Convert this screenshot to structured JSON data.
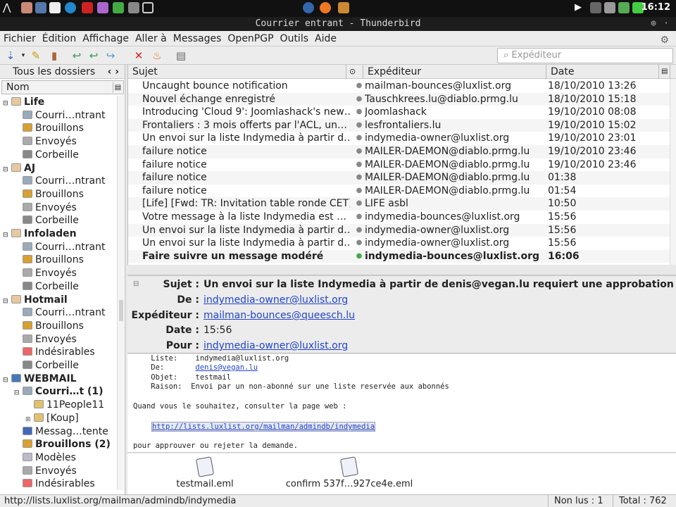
{
  "system_bar": {
    "clock": "16:12"
  },
  "window": {
    "title": "Courrier entrant - Thunderbird"
  },
  "menu": [
    "Fichier",
    "Édition",
    "Affichage",
    "Aller à",
    "Messages",
    "OpenPGP",
    "Outils",
    "Aide"
  ],
  "toolbar": {
    "search_placeholder": "Expéditeur"
  },
  "folder_pane": {
    "header": "Tous les dossiers",
    "header_toggle": "‹ ›",
    "column": "Nom",
    "folders": [
      {
        "label": "Life",
        "bold": true,
        "level": 0,
        "icon": "account-icon",
        "twisty": "⊟"
      },
      {
        "label": "Courri…ntrant",
        "level": 1,
        "icon": "inbox-icon"
      },
      {
        "label": "Brouillons",
        "level": 1,
        "icon": "drafts-icon"
      },
      {
        "label": "Envoyés",
        "level": 1,
        "icon": "sent-icon"
      },
      {
        "label": "Corbeille",
        "level": 1,
        "icon": "trash-icon"
      },
      {
        "label": "AJ",
        "bold": true,
        "level": 0,
        "icon": "account-icon",
        "twisty": "⊟"
      },
      {
        "label": "Courri…ntrant",
        "level": 1,
        "icon": "inbox-icon"
      },
      {
        "label": "Brouillons",
        "level": 1,
        "icon": "drafts-icon"
      },
      {
        "label": "Envoyés",
        "level": 1,
        "icon": "sent-icon"
      },
      {
        "label": "Corbeille",
        "level": 1,
        "icon": "trash-icon"
      },
      {
        "label": "Infoladen",
        "bold": true,
        "level": 0,
        "icon": "account-icon",
        "twisty": "⊟"
      },
      {
        "label": "Courri…ntrant",
        "level": 1,
        "icon": "inbox-icon"
      },
      {
        "label": "Brouillons",
        "level": 1,
        "icon": "drafts-icon"
      },
      {
        "label": "Envoyés",
        "level": 1,
        "icon": "sent-icon"
      },
      {
        "label": "Corbeille",
        "level": 1,
        "icon": "trash-icon"
      },
      {
        "label": "Hotmail",
        "bold": true,
        "level": 0,
        "icon": "account-icon",
        "twisty": "⊟"
      },
      {
        "label": "Courri…ntrant",
        "level": 1,
        "icon": "inbox-icon"
      },
      {
        "label": "Brouillons",
        "level": 1,
        "icon": "drafts-icon"
      },
      {
        "label": "Envoyés",
        "level": 1,
        "icon": "sent-icon"
      },
      {
        "label": "Indésirables",
        "level": 1,
        "icon": "junk-icon"
      },
      {
        "label": "Corbeille",
        "level": 1,
        "icon": "trash-icon"
      },
      {
        "label": "WEBMAIL",
        "bold": true,
        "level": 0,
        "icon": "imap-account-icon",
        "twisty": "⊟"
      },
      {
        "label": "Courri…t (1)",
        "bold": true,
        "level": 1,
        "icon": "inbox-icon",
        "twisty": "⊟"
      },
      {
        "label": "11People11",
        "level": 2,
        "icon": "folder-icon"
      },
      {
        "label": "[Koup]",
        "level": 2,
        "icon": "folder-icon",
        "twisty": "⊞"
      },
      {
        "label": "Messag…tente",
        "level": 1,
        "icon": "outbox-icon"
      },
      {
        "label": "Brouillons (2)",
        "bold": true,
        "level": 1,
        "icon": "drafts-icon"
      },
      {
        "label": "Modèles",
        "level": 1,
        "icon": "templates-icon"
      },
      {
        "label": "Envoyés",
        "level": 1,
        "icon": "sent-icon"
      },
      {
        "label": "Indésirables",
        "level": 1,
        "icon": "junk-icon"
      }
    ]
  },
  "thread_pane": {
    "columns": {
      "subject": "Sujet",
      "from": "Expéditeur",
      "date": "Date"
    },
    "rows": [
      {
        "subject": "Uncaught bounce notification",
        "from": "mailman-bounces@luxlist.org",
        "date": "18/10/2010 13:26"
      },
      {
        "subject": "Nouvel échange enregistré",
        "from": "Tauschkrees.lu@diablo.prmg.lu",
        "date": "18/10/2010 15:18"
      },
      {
        "subject": "Introducing 'Cloud 9': Joomlashack's new…",
        "from": "Joomlashack",
        "date": "19/10/2010 08:08"
      },
      {
        "subject": "Frontaliers : 3 mois offerts par l'ACL, un…",
        "from": "lesfrontaliers.lu",
        "date": "19/10/2010 15:02"
      },
      {
        "subject": "Un envoi sur la liste Indymedia à partir d…",
        "from": "indymedia-owner@luxlist.org",
        "date": "19/10/2010 23:01"
      },
      {
        "subject": "failure notice",
        "from": "MAILER-DAEMON@diablo.prmg.lu",
        "date": "19/10/2010 23:46"
      },
      {
        "subject": "failure notice",
        "from": "MAILER-DAEMON@diablo.prmg.lu",
        "date": "19/10/2010 23:46"
      },
      {
        "subject": "failure notice",
        "from": "MAILER-DAEMON@diablo.prmg.lu",
        "date": "01:38"
      },
      {
        "subject": "failure notice",
        "from": "MAILER-DAEMON@diablo.prmg.lu",
        "date": "01:54"
      },
      {
        "subject": "[Life] [Fwd: TR: Invitation table ronde CET]",
        "from": "LIFE asbl",
        "date": "10:50"
      },
      {
        "subject": "Votre message à la liste Indymedia est …",
        "from": "indymedia-bounces@luxlist.org",
        "date": "15:56"
      },
      {
        "subject": "Un envoi sur la liste Indymedia à partir d…",
        "from": "indymedia-owner@luxlist.org",
        "date": "15:56"
      },
      {
        "subject": "Un envoi sur la liste Indymedia à partir d…",
        "from": "indymedia-owner@luxlist.org",
        "date": "15:56"
      },
      {
        "subject": "Faire suivre un message modéré",
        "from": "indymedia-bounces@luxlist.org",
        "date": "16:06",
        "unread": true
      }
    ]
  },
  "message_header": {
    "subject_label": "Sujet :",
    "subject": "Un envoi sur la liste Indymedia à partir de denis@vegan.lu requiert une approbation",
    "to_label": "De :",
    "to": "indymedia-owner@luxlist.org",
    "from_label": "Expéditeur :",
    "from": "mailman-bounces@queesch.lu",
    "date_label": "Date :",
    "date": "15:56",
    "reply_label": "Pour :",
    "reply": "indymedia-owner@luxlist.org"
  },
  "message_body": {
    "list_line": "    Liste:    indymedia@luxlist.org",
    "from_line_label": "    De:       ",
    "from_line_value": "denis@vegan.lu",
    "object_line": "    Objet:    testmail",
    "reason_line": "    Raison:  Envoi par un non-abonné sur une liste reservée aux abonnés",
    "consult_line": "Quand vous le souhaitez, consulter la page web :",
    "url": "http://lists.luxlist.org/mailman/admindb/indymedia",
    "approve_line": "pour approuver ou rejeter la demande."
  },
  "attachments": [
    "testmail.eml",
    "confirm 537f…927ce4e.eml"
  ],
  "status_bar": {
    "url": "http://lists.luxlist.org/mailman/admindb/indymedia",
    "unread": "Non lus : 1",
    "total": "Total : 762"
  }
}
